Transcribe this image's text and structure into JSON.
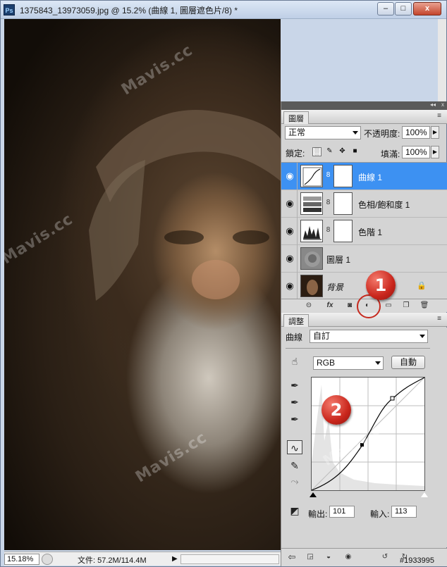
{
  "window": {
    "title": "1375843_13973059.jpg @ 15.2% (曲線 1, 圖層遮色片/8) *",
    "app_icon": "Ps",
    "minimize": "‒",
    "maximize": "□",
    "close": "x"
  },
  "watermark": "Mavis.cc",
  "status": {
    "zoom": "15.18%",
    "doc_info": "文件: 57.2M/114.4M"
  },
  "layers_panel": {
    "tab": "圖層",
    "blend_mode": "正常",
    "opacity_label": "不透明度:",
    "opacity_value": "100%",
    "lock_label": "鎖定:",
    "fill_label": "填滿:",
    "fill_value": "100%",
    "layers": [
      {
        "name": "曲線 1",
        "selected": true
      },
      {
        "name": "色相/飽和度 1",
        "selected": false
      },
      {
        "name": "色階 1",
        "selected": false
      },
      {
        "name": "圖層 1",
        "selected": false
      },
      {
        "name": "背景",
        "selected": false
      }
    ]
  },
  "adjustments_panel": {
    "tab": "調整",
    "type_label": "曲線",
    "preset_value": "自訂",
    "channel_value": "RGB",
    "auto_label": "自動",
    "output_label": "輸出:",
    "output_value": "101",
    "input_label": "輸入:",
    "input_value": "113"
  },
  "badges": [
    "1",
    "2"
  ],
  "image_id": "#1933995"
}
